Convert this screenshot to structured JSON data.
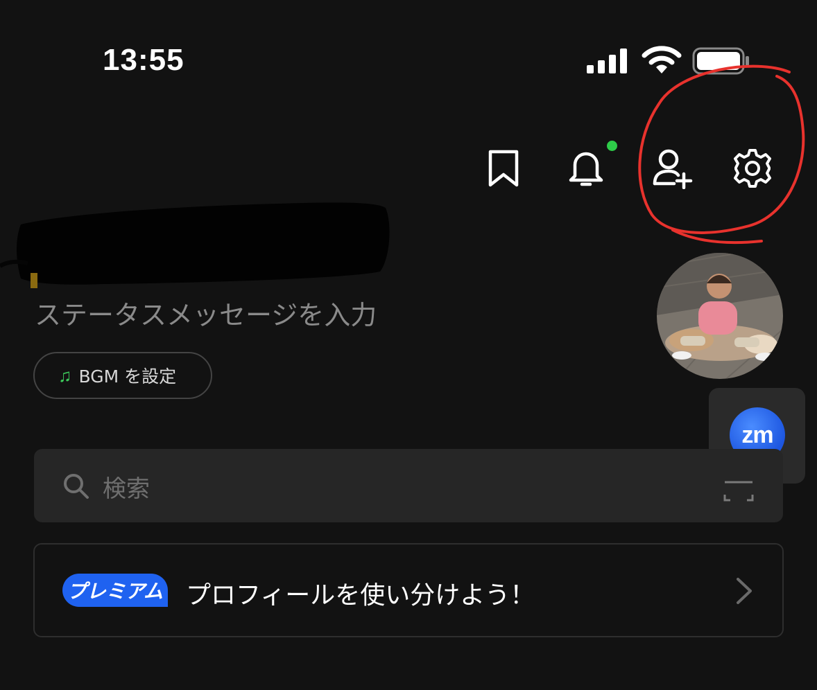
{
  "status_bar": {
    "time": "13:55"
  },
  "header": {
    "icons": [
      "bookmark-icon",
      "bell-icon",
      "add-friend-icon",
      "gear-icon"
    ],
    "notification_dot_color": "#2ecc49",
    "annotation_color": "#e8322d"
  },
  "profile": {
    "status_message_placeholder": "ステータスメッセージを入力",
    "bgm_button_label": "BGM を設定"
  },
  "floating": {
    "zoom_label": "zm"
  },
  "search": {
    "placeholder": "検索"
  },
  "premium_banner": {
    "badge": "プレミアム",
    "text": "プロフィールを使い分けよう！",
    "badge_color": "#1f62f0"
  }
}
